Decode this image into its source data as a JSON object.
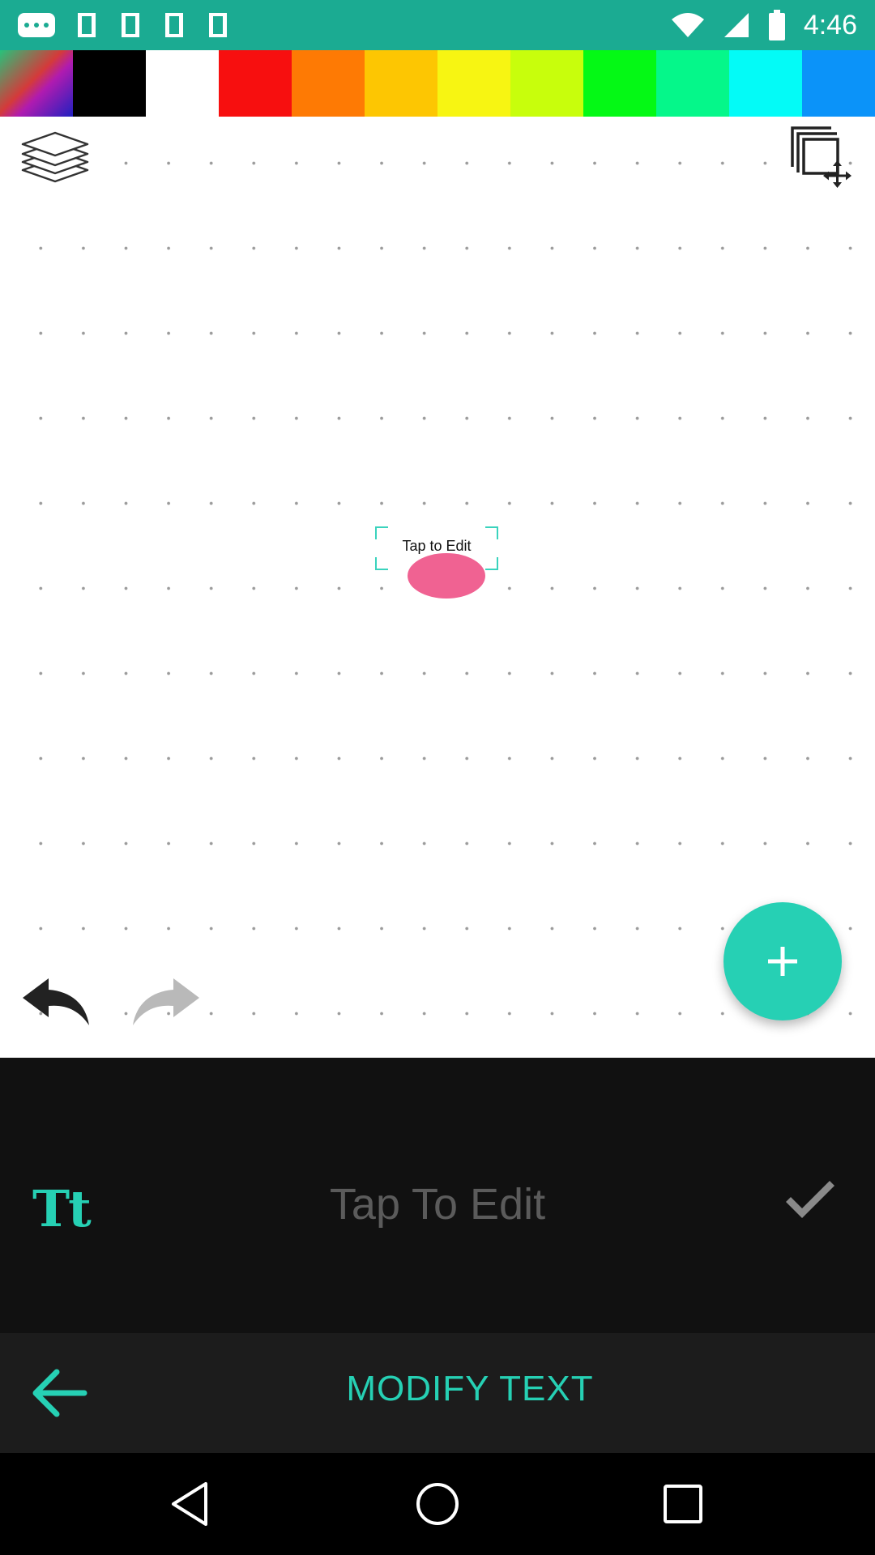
{
  "status_bar": {
    "time": "4:46",
    "icons": [
      "more-dots-icon",
      "square-icon-1",
      "square-icon-2",
      "square-icon-3",
      "square-icon-4",
      "wifi-icon",
      "signal-icon",
      "battery-icon"
    ],
    "color": "#1bab92"
  },
  "palette": {
    "colors": [
      {
        "name": "spectrum",
        "value": "linear-gradient"
      },
      {
        "name": "black",
        "value": "#000000"
      },
      {
        "name": "white",
        "value": "#ffffff"
      },
      {
        "name": "red",
        "value": "#f70f0f"
      },
      {
        "name": "orange",
        "value": "#fe7a04"
      },
      {
        "name": "amber",
        "value": "#fdc602"
      },
      {
        "name": "yellow",
        "value": "#f7f512"
      },
      {
        "name": "lime",
        "value": "#c8fe0c"
      },
      {
        "name": "green",
        "value": "#04f915"
      },
      {
        "name": "spring-green",
        "value": "#05f78a"
      },
      {
        "name": "cyan",
        "value": "#03fbf7"
      },
      {
        "name": "blue",
        "value": "#0b93f9"
      }
    ]
  },
  "canvas": {
    "text_box_label": "Tap to Edit",
    "blob_color": "#f06292"
  },
  "edit_panel": {
    "font_icon_label": "Tt",
    "text_value": "Tap To Edit"
  },
  "action_bar": {
    "title": "MODIFY TEXT"
  },
  "accent_color": "#26d0b4"
}
